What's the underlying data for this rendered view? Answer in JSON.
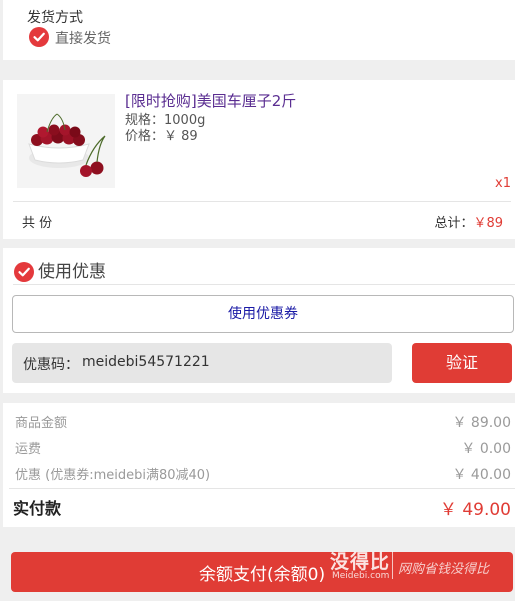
{
  "shipping": {
    "title": "发货方式",
    "option": "直接发货"
  },
  "product": {
    "name": "[限时抢购]美国车厘子2斤",
    "spec": "规格：1000g",
    "price": "价格：￥ 89",
    "qty": "x1",
    "image_icon": "cherries-photo"
  },
  "summary": {
    "count_label": "共 份",
    "total_label": "总计：",
    "total_value": "￥89"
  },
  "coupon": {
    "title": "使用优惠",
    "use_button": "使用优惠券",
    "code_label": "优惠码：",
    "code_value": "meidebi54571221",
    "verify_button": "验证"
  },
  "amounts": {
    "rows": [
      {
        "label": "商品金额",
        "value": "￥ 89.00"
      },
      {
        "label": "运费",
        "value": "￥ 0.00"
      },
      {
        "label": "优惠 (优惠券:meidebi满80减40)",
        "value": "￥ 40.00"
      }
    ],
    "pay_label": "实付款",
    "pay_value": "￥ 49.00"
  },
  "footer": {
    "pay_button": "余额支付(余额0)",
    "watermark_main": "没得比",
    "watermark_sub": "Meidebi.com",
    "watermark_slogan": "网购省钱没得比"
  },
  "colors": {
    "accent": "#e03c35",
    "link_purple": "#5a2d91"
  }
}
